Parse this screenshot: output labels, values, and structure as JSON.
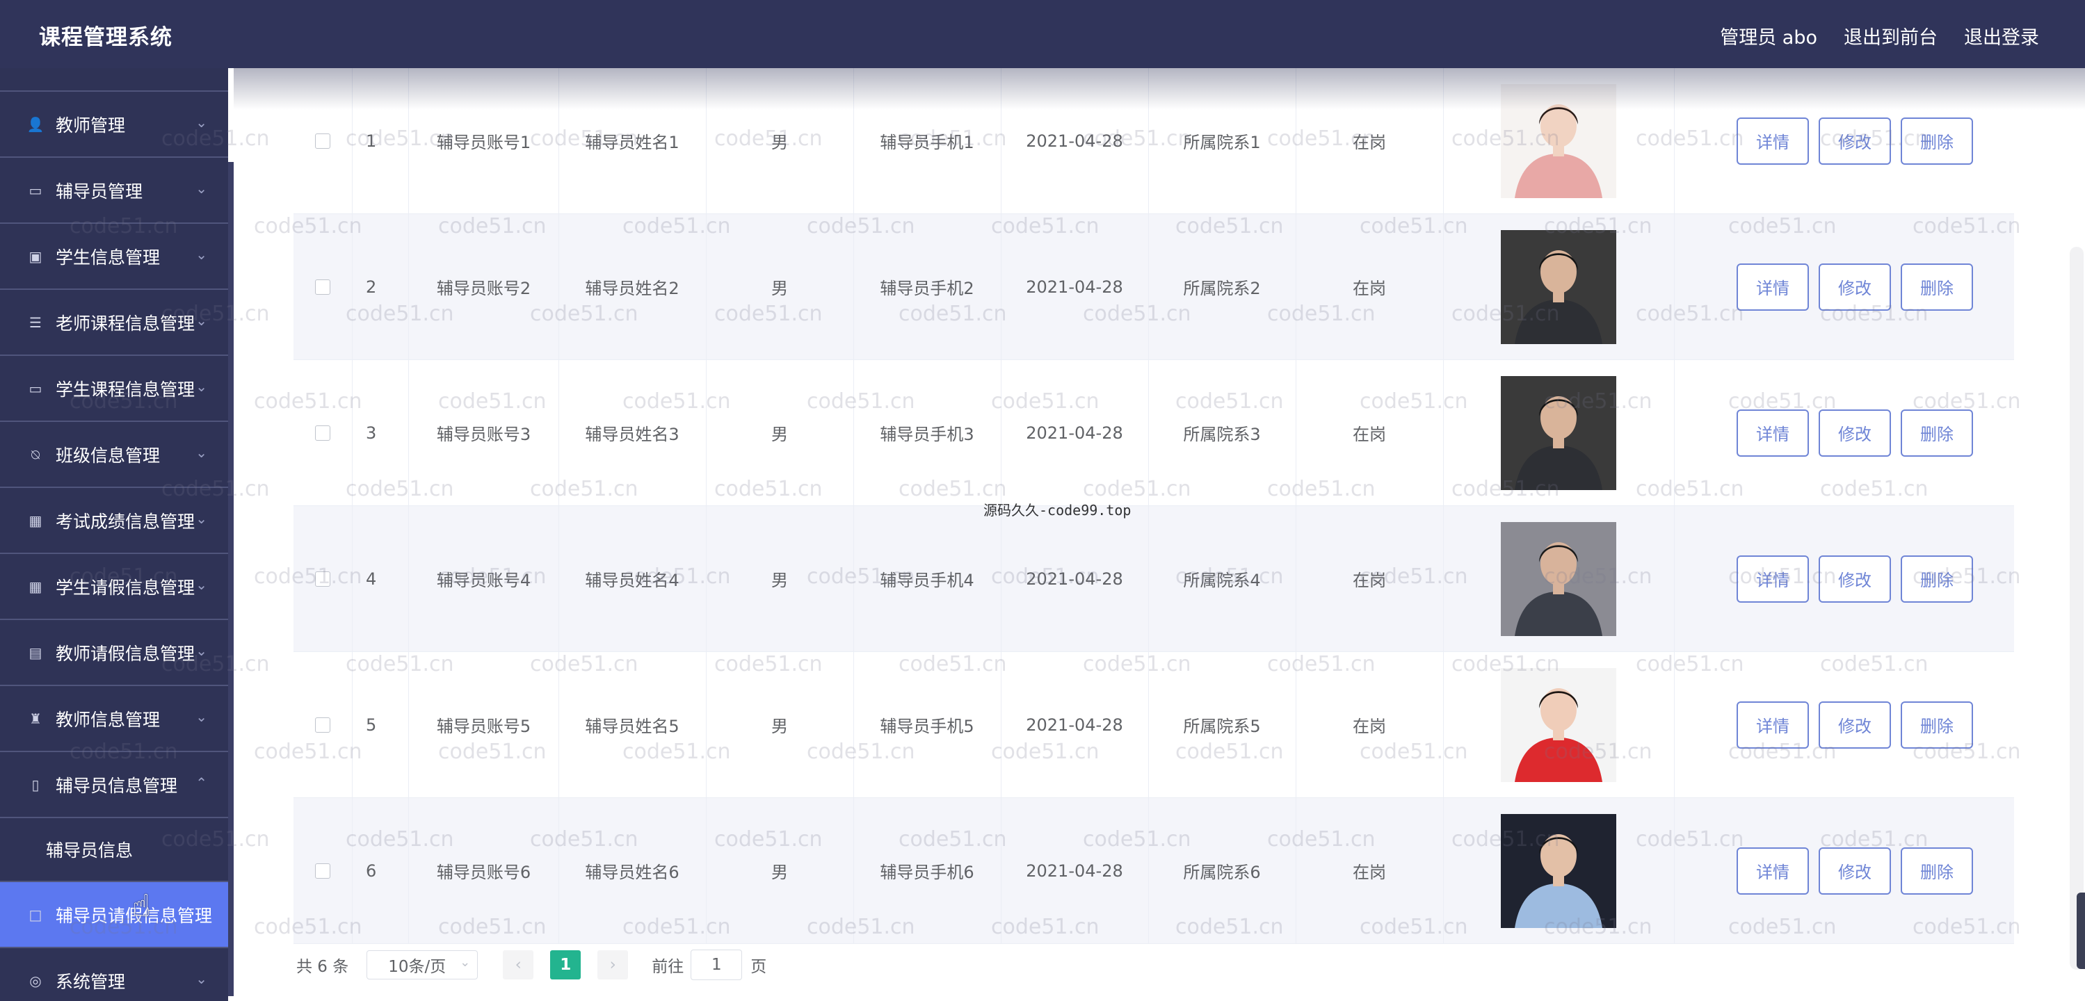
{
  "header": {
    "title": "课程管理系统",
    "user_label": "管理员 abo",
    "to_front": "退出到前台",
    "logout": "退出登录"
  },
  "sidebar": {
    "items": [
      {
        "label": "教师管理",
        "icon": "user-icon"
      },
      {
        "label": "辅导员管理",
        "icon": "monitor-icon"
      },
      {
        "label": "学生信息管理",
        "icon": "id-card-icon"
      },
      {
        "label": "老师课程信息管理",
        "icon": "list-icon"
      },
      {
        "label": "学生课程信息管理",
        "icon": "monitor-icon"
      },
      {
        "label": "班级信息管理",
        "icon": "bell-off-icon"
      },
      {
        "label": "考试成绩信息管理",
        "icon": "grid-plus-icon"
      },
      {
        "label": "学生请假信息管理",
        "icon": "grid-icon"
      },
      {
        "label": "教师请假信息管理",
        "icon": "clipboard-icon"
      },
      {
        "label": "教师信息管理",
        "icon": "trophy-icon"
      },
      {
        "label": "辅导员信息管理",
        "icon": "phone-icon"
      }
    ],
    "sub_item": "辅导员信息",
    "active_item": "辅导员请假信息管理",
    "last_item": "系统管理"
  },
  "table": {
    "rows": [
      {
        "index": "1",
        "account": "辅导员账号1",
        "name": "辅导员姓名1",
        "sex": "男",
        "phone": "辅导员手机1",
        "date": "2021-04-28",
        "dept": "所属院系1",
        "status": "在岗",
        "photo": "female-portrait-pink"
      },
      {
        "index": "2",
        "account": "辅导员账号2",
        "name": "辅导员姓名2",
        "sex": "男",
        "phone": "辅导员手机2",
        "date": "2021-04-28",
        "dept": "所属院系2",
        "status": "在岗",
        "photo": "male-portrait-suit-seated"
      },
      {
        "index": "3",
        "account": "辅导员账号3",
        "name": "辅导员姓名3",
        "sex": "男",
        "phone": "辅导员手机3",
        "date": "2021-04-28",
        "dept": "所属院系3",
        "status": "在岗",
        "photo": "male-portrait-suit-seated"
      },
      {
        "index": "4",
        "account": "辅导员账号4",
        "name": "辅导员姓名4",
        "sex": "男",
        "phone": "辅导员手机4",
        "date": "2021-04-28",
        "dept": "所属院系4",
        "status": "在岗",
        "photo": "male-portrait-suit-standing"
      },
      {
        "index": "5",
        "account": "辅导员账号5",
        "name": "辅导员姓名5",
        "sex": "男",
        "phone": "辅导员手机5",
        "date": "2021-04-28",
        "dept": "所属院系5",
        "status": "在岗",
        "photo": "female-portrait-red"
      },
      {
        "index": "6",
        "account": "辅导员账号6",
        "name": "辅导员姓名6",
        "sex": "男",
        "phone": "辅导员手机6",
        "date": "2021-04-28",
        "dept": "所属院系6",
        "status": "在岗",
        "photo": "male-portrait-blue-shirt"
      }
    ],
    "actions": {
      "detail": "详情",
      "edit": "修改",
      "delete": "删除"
    }
  },
  "pagination": {
    "total": "共 6 条",
    "page_size": "10条/页",
    "current_page": "1",
    "goto_label": "前往",
    "goto_value": "1",
    "page_suffix": "页"
  },
  "watermark": {
    "text": "code51.cn",
    "center": "源码久久-code99.top"
  },
  "colors": {
    "header_bg": "#30345a",
    "sidebar_bg": "#2f3356",
    "active_item_bg": "#5c78f0",
    "button_border": "#6f85d6",
    "page_active": "#23b48f"
  }
}
